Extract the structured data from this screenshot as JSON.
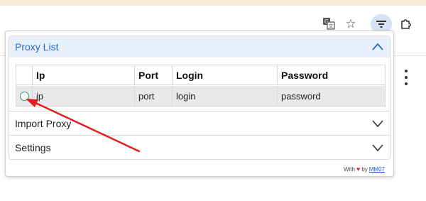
{
  "browser": {
    "icons": [
      "translate-icon",
      "star-icon",
      "filter-icon",
      "puzzle-icon",
      "kebab-menu-icon"
    ]
  },
  "popup": {
    "proxy_list": {
      "title": "Proxy List",
      "columns": [
        "Ip",
        "Port",
        "Login",
        "Password"
      ],
      "rows": [
        {
          "ip": "ip",
          "port": "port",
          "login": "login",
          "password": "password"
        }
      ]
    },
    "import_proxy": {
      "title": "Import Proxy"
    },
    "settings": {
      "title": "Settings"
    },
    "footer": {
      "prefix": "With",
      "by": "by",
      "author": "MM07"
    }
  },
  "colors": {
    "accent": "#2a6cc4",
    "header_bg": "#e7f1fc",
    "row_bg": "#e9e9eb",
    "annotation_arrow": "#e02020",
    "radio": "#2a9d55",
    "heart": "#e0304a"
  }
}
